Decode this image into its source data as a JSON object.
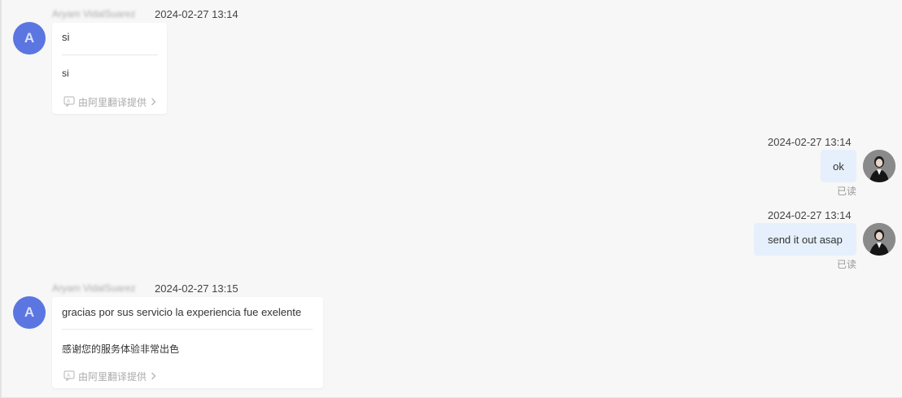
{
  "messages": [
    {
      "sender_name": "Aryam VidalSuarez",
      "avatar_letter": "A",
      "time": "2024-02-27 13:14",
      "original": "si",
      "translation": "si",
      "provider": "由阿里翻译提供"
    },
    {
      "time": "2024-02-27 13:14",
      "text": "ok",
      "status": "已读"
    },
    {
      "time": "2024-02-27 13:14",
      "text": "send it out asap",
      "status": "已读"
    },
    {
      "sender_name": "Aryam VidalSuarez",
      "avatar_letter": "A",
      "time": "2024-02-27 13:15",
      "original": "gracias por sus servicio la experiencia fue exelente",
      "translation": "感谢您的服务体验非常出色",
      "provider": "由阿里翻译提供"
    }
  ],
  "colors": {
    "background": "#f7f7f7",
    "avatar_bg": "#5b76e0",
    "outgoing_bubble": "#e6f0fc",
    "card": "#ffffff"
  },
  "icons": {
    "translate": "translate-icon",
    "chevron": "chevron-right-icon"
  }
}
